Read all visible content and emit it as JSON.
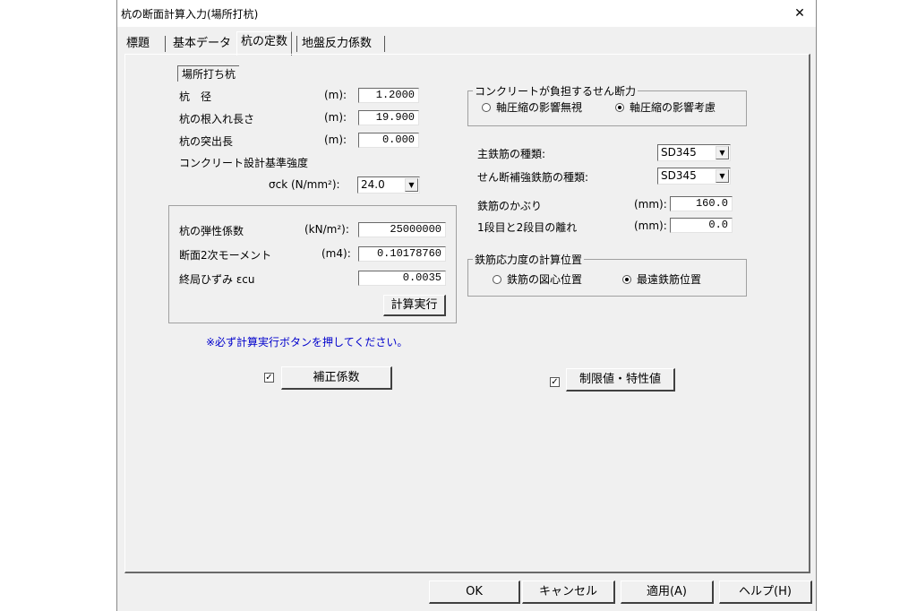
{
  "window": {
    "title": "杭の断面計算入力(場所打杭)",
    "close": "✕"
  },
  "tabs": [
    {
      "label": "標題"
    },
    {
      "label": "基本データ"
    },
    {
      "label": "杭の定数"
    },
    {
      "label": "地盤反力係数"
    }
  ],
  "pile_type_label": "場所打ち杭",
  "fields": {
    "diameter": {
      "label": "杭　径",
      "unit": "(m):",
      "value": "1.2000"
    },
    "embed_length": {
      "label": "杭の根入れ長さ",
      "unit": "(m):",
      "value": "19.900"
    },
    "protrusion": {
      "label": "杭の突出長",
      "unit": "(m):",
      "value": "0.000"
    },
    "concrete_strength": {
      "label": "コンクリート設計基準強度",
      "unit": "σck (N/mm²):",
      "value": "24.0"
    }
  },
  "calc_group": {
    "elastic": {
      "label": "杭の弾性係数",
      "unit": "(kN/m²):",
      "value": "25000000"
    },
    "inertia": {
      "label": "断面2次モーメント",
      "unit": "(m4):",
      "value": "0.10178760"
    },
    "strain": {
      "label": "終局ひずみ εcu",
      "value": "0.0035"
    },
    "exec_button": "計算実行"
  },
  "note": "※必ず計算実行ボタンを押してください。",
  "correction": {
    "checked": true,
    "button": "補正係数"
  },
  "shear_group": {
    "title": "コンクリートが負担するせん断力",
    "options": [
      {
        "label": "軸圧縮の影響無視",
        "selected": false
      },
      {
        "label": "軸圧縮の影響考慮",
        "selected": true
      }
    ]
  },
  "rebar": {
    "main": {
      "label": "主鉄筋の種類:",
      "value": "SD345"
    },
    "shear": {
      "label": "せん断補強鉄筋の種類:",
      "value": "SD345"
    },
    "cover": {
      "label": "鉄筋のかぶり",
      "unit": "(mm):",
      "value": "160.0"
    },
    "spacing": {
      "label": "1段目と2段目の離れ",
      "unit": "(mm):",
      "value": "0.0"
    }
  },
  "stress_group": {
    "title": "鉄筋応力度の計算位置",
    "options": [
      {
        "label": "鉄筋の図心位置",
        "selected": false
      },
      {
        "label": "最遠鉄筋位置",
        "selected": true
      }
    ]
  },
  "limit": {
    "checked": true,
    "button": "制限値・特性値"
  },
  "footer": {
    "ok": "OK",
    "cancel": "キャンセル",
    "apply": "適用(A)",
    "help": "ヘルプ(H)"
  },
  "check_mark": "✓",
  "dropdown_arrow": "▼"
}
